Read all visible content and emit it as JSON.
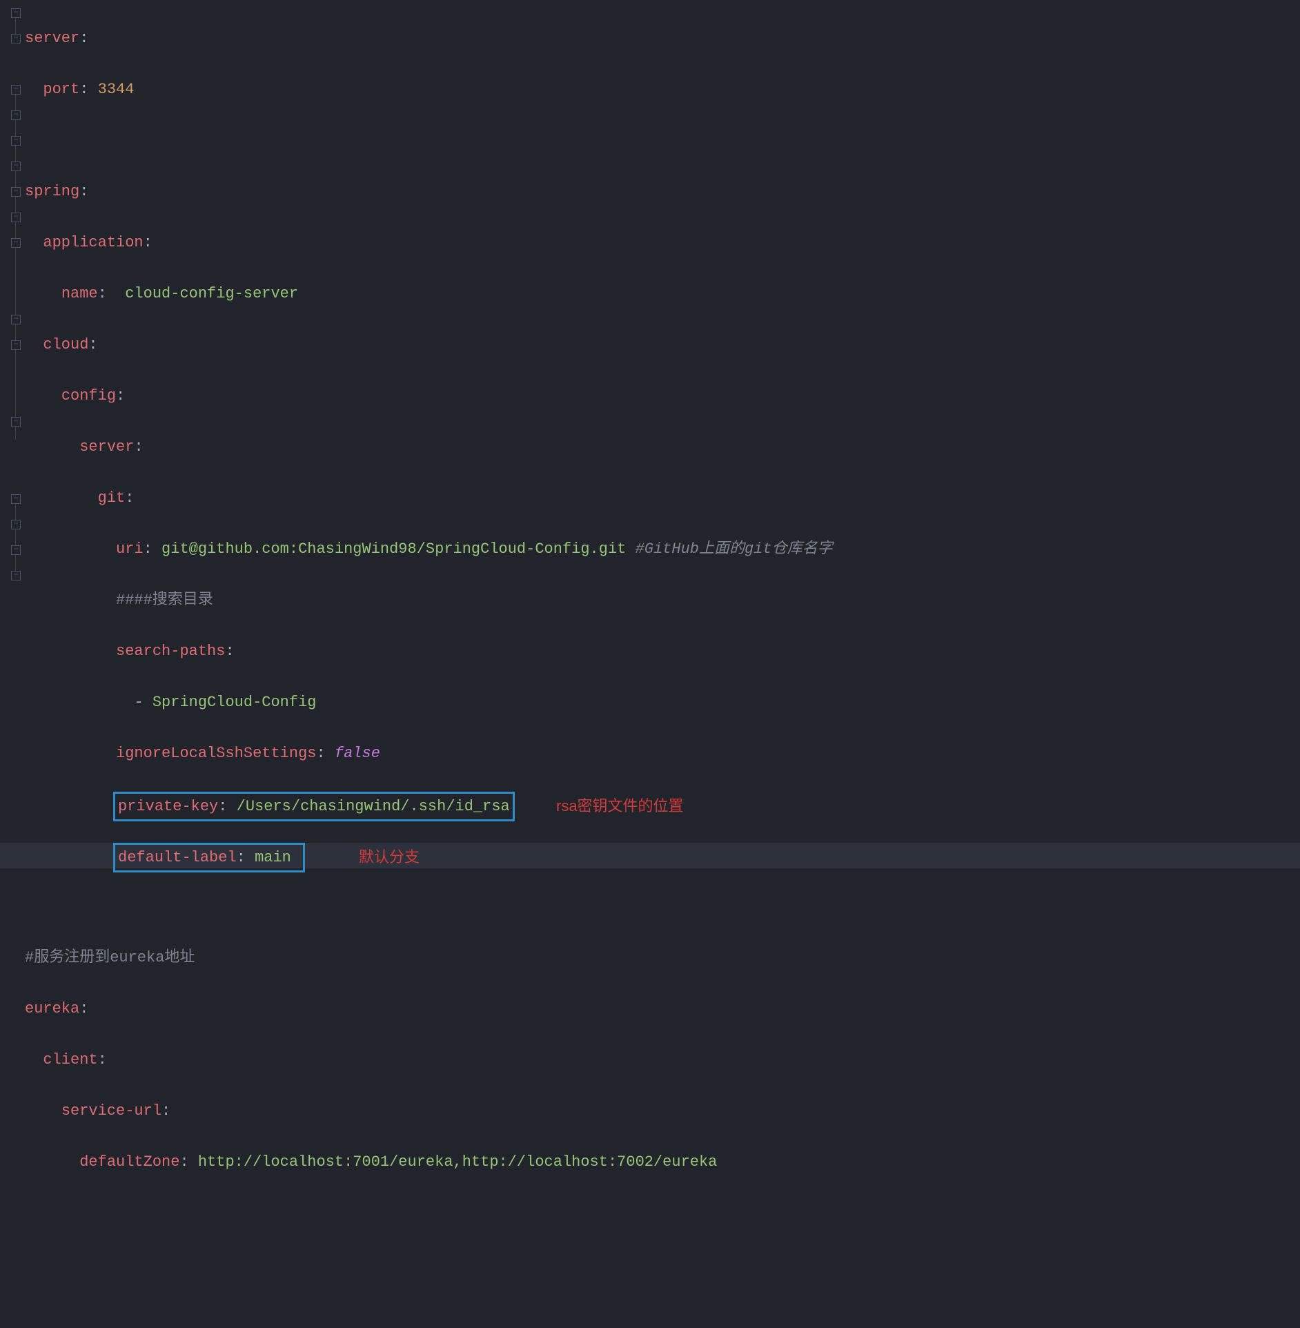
{
  "yaml": {
    "server_key": "server",
    "port_key": "port",
    "port_val": "3344",
    "spring_key": "spring",
    "application_key": "application",
    "name_key": "name",
    "name_val": "cloud-config-server",
    "cloud_key": "cloud",
    "config_key": "config",
    "server2_key": "server",
    "git_key": "git",
    "uri_key": "uri",
    "uri_val": "git@github.com:ChasingWind98/SpringCloud-Config.git",
    "uri_comment": "#GitHub上面的git仓库名字",
    "search_comment": "####搜索目录",
    "searchpaths_key": "search-paths",
    "searchpaths_item": "SpringCloud-Config",
    "ignorelocal_key": "ignoreLocalSshSettings",
    "ignorelocal_val": "false",
    "privatekey_key": "private-key",
    "privatekey_val": "/Users/chasingwind/.ssh/id_rsa",
    "defaultlabel_key": "default-label",
    "defaultlabel_val": "main",
    "eureka_comment": "#服务注册到eureka地址",
    "eureka_key": "eureka",
    "client_key": "client",
    "serviceurl_key": "service-url",
    "defaultzone_key": "defaultZone",
    "defaultzone_val": "http://localhost:7001/eureka,http://localhost:7002/eureka"
  },
  "annotations": {
    "rsa_note": "rsa密钥文件的位置",
    "branch_note": "默认分支"
  },
  "fold_glyph": "−"
}
